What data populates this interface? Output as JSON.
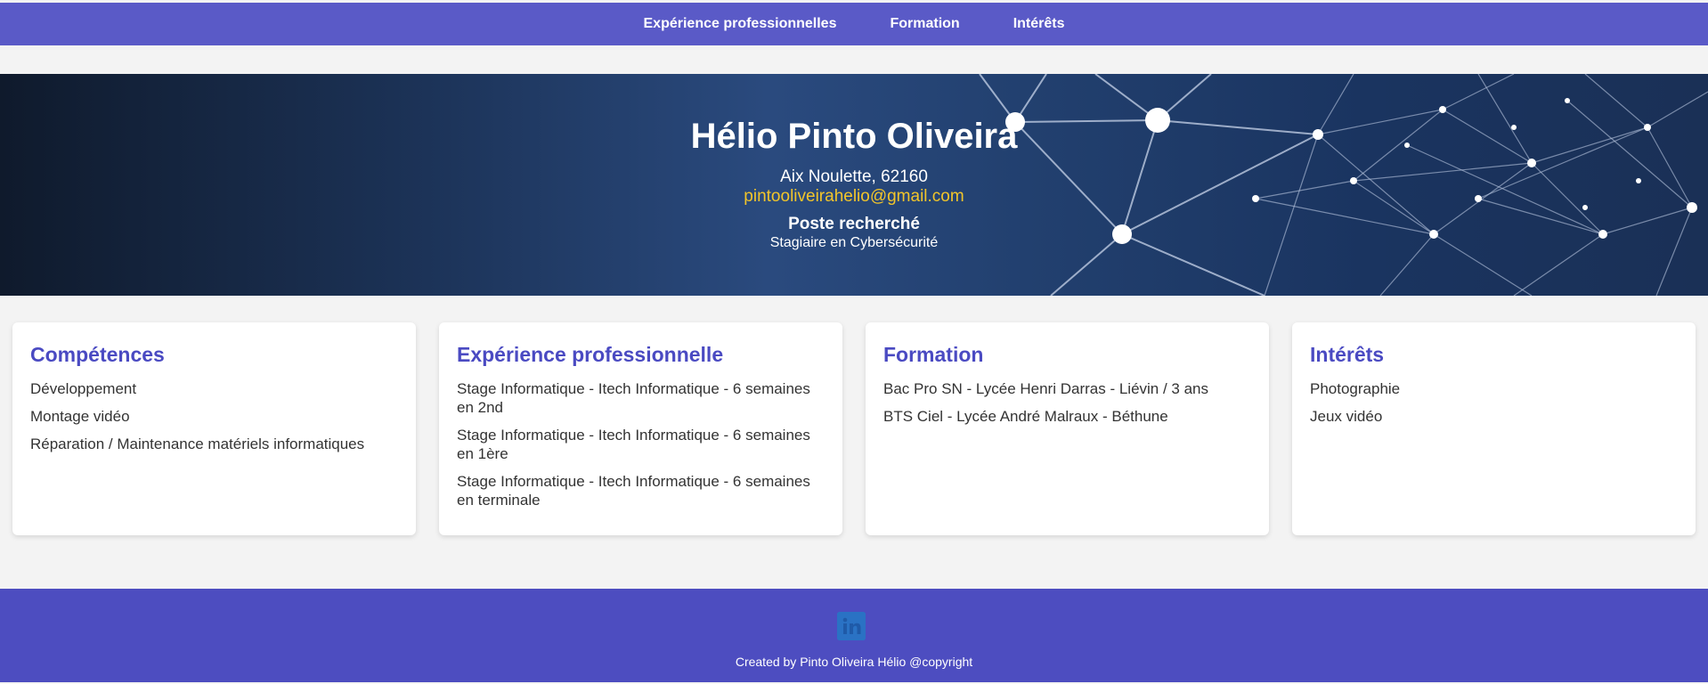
{
  "nav": {
    "items": [
      {
        "label": "Expérience professionnelles"
      },
      {
        "label": "Formation"
      },
      {
        "label": "Intérêts"
      }
    ]
  },
  "hero": {
    "name": "Hélio Pinto Oliveira",
    "address": "Aix Noulette, 62160",
    "email": "pintooliveirahelio@gmail.com",
    "poste_label": "Poste recherché",
    "poste_value": "Stagiaire en Cybersécurité"
  },
  "cards": {
    "competences": {
      "title": "Compétences",
      "items": [
        "Développement",
        "Montage vidéo",
        "Réparation / Maintenance matériels informatiques"
      ]
    },
    "experience": {
      "title": "Expérience professionnelle",
      "items": [
        "Stage Informatique - Itech Informatique - 6 semaines en 2nd",
        "Stage Informatique - Itech Informatique - 6 semaines en 1ère",
        "Stage Informatique - Itech Informatique - 6 semaines en terminale"
      ]
    },
    "formation": {
      "title": "Formation",
      "items": [
        "Bac Pro SN - Lycée Henri Darras - Liévin / 3 ans",
        "BTS Ciel - Lycée André Malraux - Béthune"
      ]
    },
    "interets": {
      "title": "Intérêts",
      "items": [
        "Photographie",
        "Jeux vidéo"
      ]
    }
  },
  "footer": {
    "icon": "linkedin-icon",
    "credit": "Created by Pinto Oliveira Hélio @copyright"
  },
  "colors": {
    "nav_bg": "#5a5ac7",
    "accent": "#4a4ac2",
    "email": "#f2c52a",
    "footer_bg": "#4d4dc0"
  }
}
